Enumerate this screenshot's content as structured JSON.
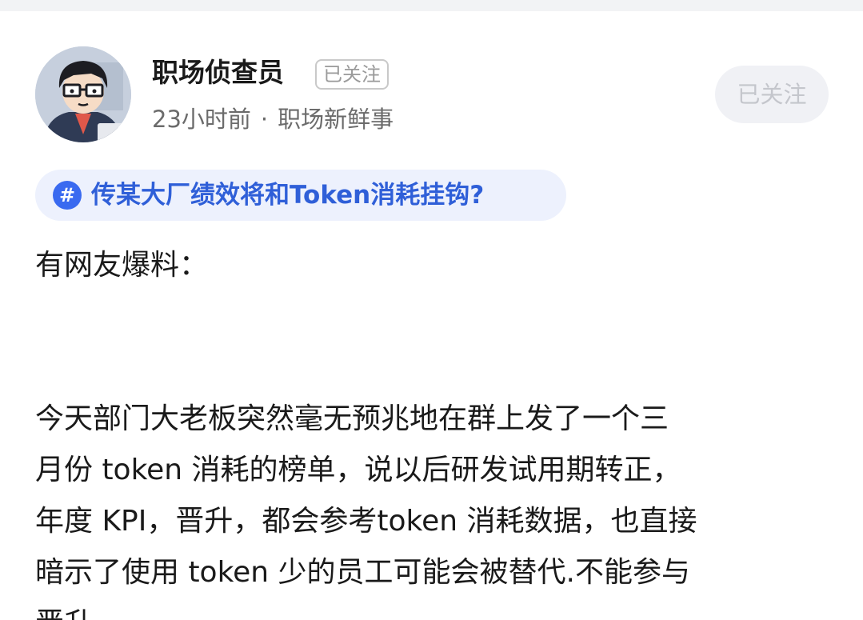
{
  "author": {
    "name": "职场侦查员",
    "tag": "已关注"
  },
  "meta": {
    "time": "23小时前",
    "separator": "·",
    "category": "职场新鲜事"
  },
  "follow_button": {
    "label": "已关注"
  },
  "topic": {
    "icon": "#",
    "text": "传某大厂绩效将和Token消耗挂钩?"
  },
  "post": {
    "intro": "有网友爆料：",
    "lines": [
      "今天部门大老板突然毫无预兆地在群上发了一个三",
      "月份 token 消耗的榜单，说以后研发试用期转正，",
      "年度 KPI，晋升，都会参考token 消耗数据，也直接",
      "暗示了使用 token 少的员工可能会被替代.不能参与",
      "晋升."
    ]
  },
  "colors": {
    "topic_blue": "#2f5fd8",
    "topic_bg": "#edf1fd",
    "button_bg": "#f0f1f5"
  }
}
